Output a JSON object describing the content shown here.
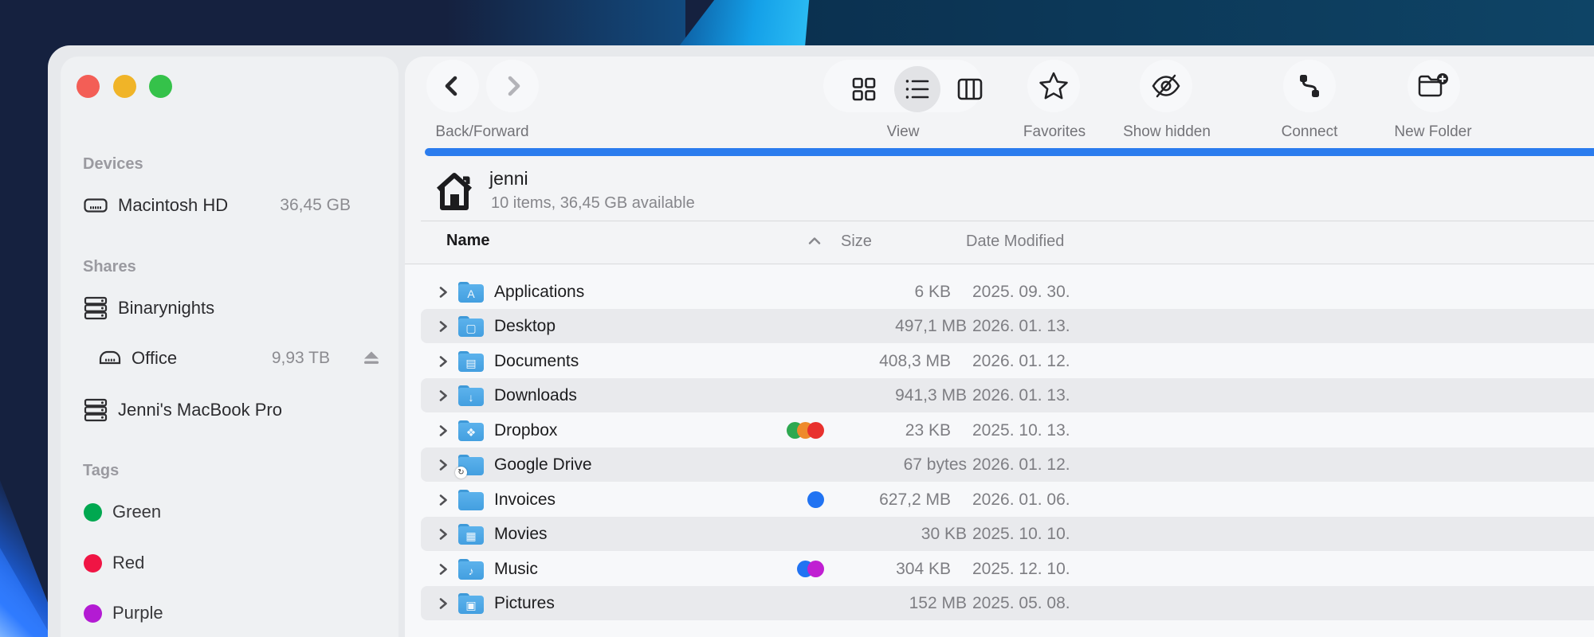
{
  "colors": {
    "accent_bar": "#2b7cee",
    "traffic": {
      "red": "#f35e56",
      "yellow": "#f0b428",
      "green": "#35c24a"
    },
    "folder_blue": "#4aa6e6"
  },
  "sidebar": {
    "sections": {
      "devices": {
        "label": "Devices",
        "items": [
          {
            "name": "Macintosh HD",
            "detail": "36,45 GB"
          }
        ]
      },
      "shares": {
        "label": "Shares",
        "items": [
          {
            "name": "Binarynights"
          },
          {
            "name": "Office",
            "detail": "9,93 TB"
          },
          {
            "name": "Jenni's MacBook Pro"
          }
        ]
      },
      "tags": {
        "label": "Tags",
        "items": [
          {
            "name": "Green",
            "color": "#00a850"
          },
          {
            "name": "Red",
            "color": "#f01544"
          },
          {
            "name": "Purple",
            "color": "#b31bd3"
          }
        ]
      }
    }
  },
  "toolbar": {
    "back_forward_label": "Back/Forward",
    "view_label": "View",
    "favorites_label": "Favorites",
    "show_hidden_label": "Show hidden",
    "connect_label": "Connect",
    "new_folder_label": "New Folder"
  },
  "header": {
    "title": "jenni",
    "subtitle": "10 items, 36,45 GB available"
  },
  "columns": {
    "name": "Name",
    "size": "Size",
    "date": "Date Modified"
  },
  "rows": [
    {
      "name": "Applications",
      "glyph": "A",
      "size": "6 KB",
      "date": "2025. 09. 30.",
      "dots": []
    },
    {
      "name": "Desktop",
      "glyph": "▢",
      "size": "497,1 MB",
      "date": "2026. 01. 13.",
      "dots": []
    },
    {
      "name": "Documents",
      "glyph": "▤",
      "size": "408,3 MB",
      "date": "2026. 01. 12.",
      "dots": []
    },
    {
      "name": "Downloads",
      "glyph": "↓",
      "size": "941,3 MB",
      "date": "2026. 01. 13.",
      "dots": []
    },
    {
      "name": "Dropbox",
      "glyph": "❖",
      "size": "23 KB",
      "date": "2025. 10. 13.",
      "dots": [
        "#2ea850",
        "#ee8a2c",
        "#e8312e"
      ]
    },
    {
      "name": "Google Drive",
      "glyph": "",
      "size": "67 bytes",
      "date": "2026. 01. 12.",
      "dots": [],
      "badge": "↻"
    },
    {
      "name": "Invoices",
      "glyph": "",
      "size": "627,2 MB",
      "date": "2026. 01. 06.",
      "dots": [
        "#2173f2"
      ]
    },
    {
      "name": "Movies",
      "glyph": "▦",
      "size": "30 KB",
      "date": "2025. 10. 10.",
      "dots": []
    },
    {
      "name": "Music",
      "glyph": "♪",
      "size": "304 KB",
      "date": "2025. 12. 10.",
      "dots": [
        "#2173f2",
        "#c01fd2"
      ]
    },
    {
      "name": "Pictures",
      "glyph": "▣",
      "size": "152 MB",
      "date": "2025. 05. 08.",
      "dots": []
    }
  ]
}
